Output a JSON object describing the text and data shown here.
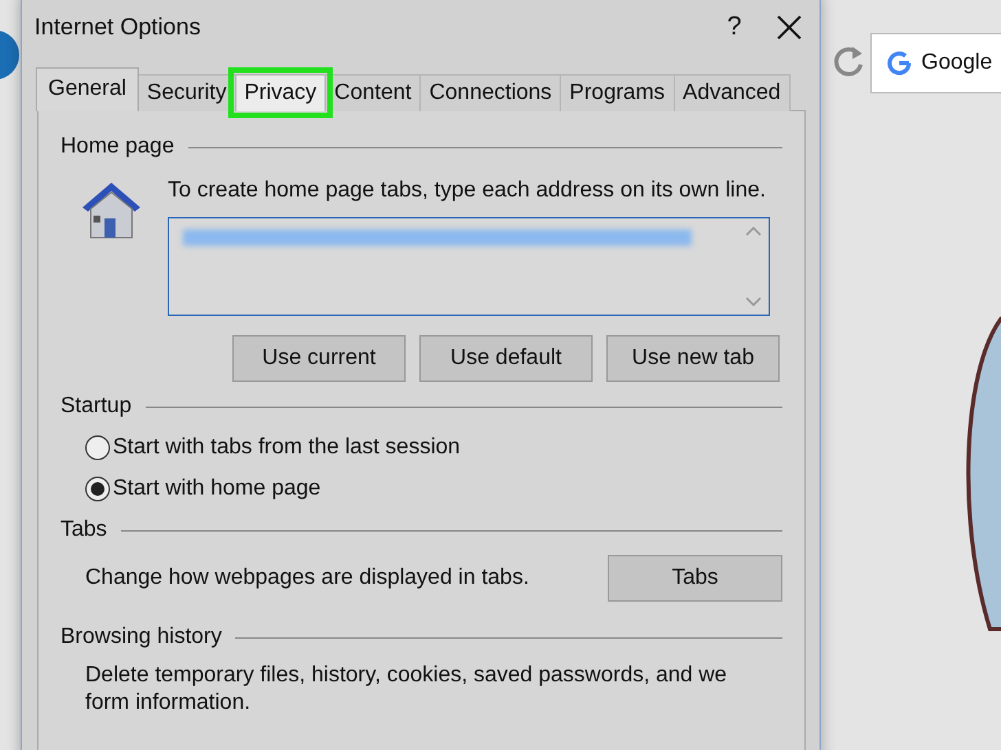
{
  "browser": {
    "search_label": "Google"
  },
  "window": {
    "title": "Internet Options",
    "help": "?"
  },
  "tabs": [
    {
      "label": "General",
      "selected": true,
      "highlighted": false
    },
    {
      "label": "Security",
      "selected": false,
      "highlighted": false
    },
    {
      "label": "Privacy",
      "selected": false,
      "highlighted": true
    },
    {
      "label": "Content",
      "selected": false,
      "highlighted": false
    },
    {
      "label": "Connections",
      "selected": false,
      "highlighted": false
    },
    {
      "label": "Programs",
      "selected": false,
      "highlighted": false
    },
    {
      "label": "Advanced",
      "selected": false,
      "highlighted": false
    }
  ],
  "home_page": {
    "heading": "Home page",
    "instruction": "To create home page tabs, type each address on its own line.",
    "buttons": [
      "Use current",
      "Use default",
      "Use new tab"
    ]
  },
  "startup": {
    "heading": "Startup",
    "options": [
      {
        "label": "Start with tabs from the last session",
        "selected": false
      },
      {
        "label": "Start with home page",
        "selected": true
      }
    ]
  },
  "tabs_section": {
    "heading": "Tabs",
    "description": "Change how webpages are displayed in tabs.",
    "button": "Tabs"
  },
  "browsing_history": {
    "heading": "Browsing history",
    "description": "Delete temporary files, history, cookies, saved passwords, and we",
    "description_2": "form information."
  }
}
